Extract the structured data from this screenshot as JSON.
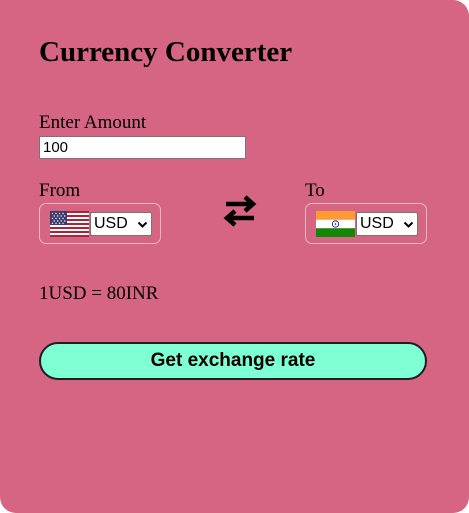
{
  "app": {
    "title": "Currency Converter"
  },
  "amount": {
    "label": "Enter Amount",
    "value": "100"
  },
  "from": {
    "label": "From",
    "currency": "USD",
    "flag": "us-flag"
  },
  "to": {
    "label": "To",
    "currency": "USD",
    "flag": "india-flag"
  },
  "swap": {
    "icon": "swap-arrows-icon"
  },
  "result": {
    "text": "1USD = 80INR"
  },
  "button": {
    "label": "Get exchange rate"
  },
  "colors": {
    "background": "#d66483",
    "button": "#7fffd4"
  }
}
